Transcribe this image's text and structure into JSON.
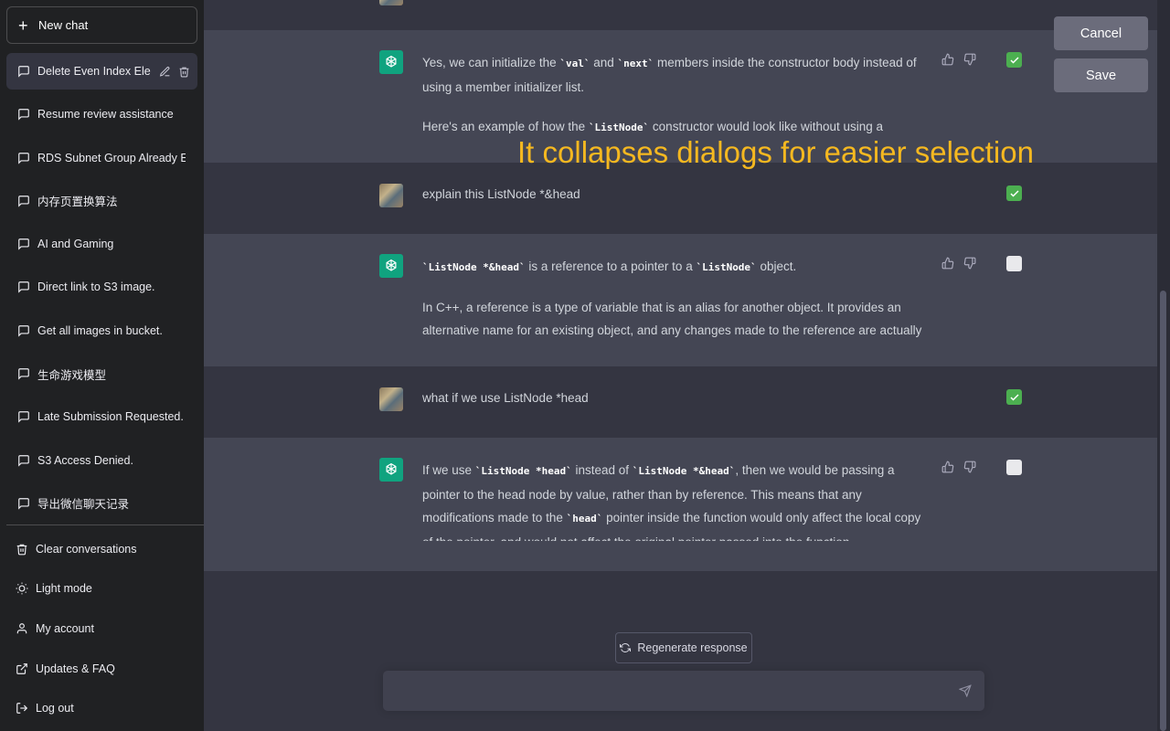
{
  "sidebar": {
    "new_chat": "New chat",
    "conversations": [
      "Delete Even Index Elements",
      "Resume review assistance",
      "RDS Subnet Group Already Exists",
      "内存页置换算法",
      "AI and Gaming",
      "Direct link to S3 image.",
      "Get all images in bucket.",
      "生命游戏模型",
      "Late Submission Requested.",
      "S3 Access Denied.",
      "导出微信聊天记录"
    ],
    "bottom": [
      {
        "label": "Clear conversations",
        "icon": "trash-icon"
      },
      {
        "label": "Light mode",
        "icon": "sun-icon"
      },
      {
        "label": "My account",
        "icon": "user-icon"
      },
      {
        "label": "Updates & FAQ",
        "icon": "external-link-icon"
      },
      {
        "label": "Log out",
        "icon": "logout-icon"
      }
    ]
  },
  "messages": [
    {
      "role": "assistant",
      "checked": true,
      "p1_a": "Yes, we can initialize the ",
      "p1_c1": "`val`",
      "p1_b": " and ",
      "p1_c2": "`next`",
      "p1_d": " members inside the constructor body instead of using a member initializer list.",
      "p2_a": "Here's an example of how the ",
      "p2_c1": "`ListNode`",
      "p2_b": " constructor would look like without using a"
    },
    {
      "role": "user",
      "checked": true,
      "text": "explain this ListNode *&head"
    },
    {
      "role": "assistant",
      "checked": false,
      "p1_c1": "`ListNode *&head`",
      "p1_a": " is a reference to a pointer to a ",
      "p1_c2": "`ListNode`",
      "p1_b": " object.",
      "p2": "In C++, a reference is a type of variable that is an alias for another object. It provides an alternative name for an existing object, and any changes made to the reference are actually"
    },
    {
      "role": "user",
      "checked": true,
      "text": "what if we use ListNode *head"
    },
    {
      "role": "assistant",
      "checked": false,
      "a": "If we use ",
      "c1": "`ListNode *head`",
      "b": " instead of ",
      "c2": "`ListNode *&head`",
      "c": ", then we would be passing a pointer to the head node by value, rather than by reference. This means that any modifications made to the ",
      "c3": "`head`",
      "d": " pointer inside the function would only affect the local copy of the pointer, and would not affect the original pointer passed into the function."
    }
  ],
  "overlay": "It collapses dialogs for easier selection",
  "buttons": {
    "cancel": "Cancel",
    "save": "Save",
    "regenerate": "Regenerate response"
  },
  "colors": {
    "accent_gpt": "#10a37f",
    "checkbox_checked": "#4caf50",
    "overlay": "#f5b820"
  }
}
